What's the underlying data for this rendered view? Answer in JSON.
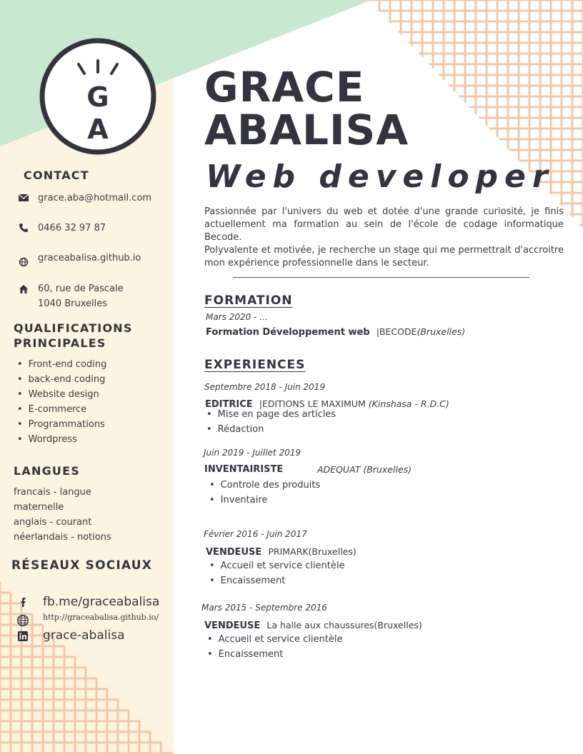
{
  "colors": {
    "mint": "#c9e8d0",
    "cream": "#fcf4e0",
    "grid": "#f1c6a3",
    "dark": "#33343f"
  },
  "logo": {
    "initial_top": "G",
    "initial_bottom": "A"
  },
  "header": {
    "first_name": "GRACE",
    "last_name": "ABALISA",
    "job_title": "Web developer"
  },
  "summary": {
    "p1": "Passionnée par l'univers du web et dotée d'une grande curiosité, je finis actuellement ma formation au sein de l'école de codage informatique Becode.",
    "p2": "Polyvalente et motivée, je recherche un stage qui me permettrait d'accroitre mon expérience professionnelle dans le secteur."
  },
  "contact": {
    "heading": "CONTACT",
    "items": [
      {
        "icon": "envelope-icon",
        "text": "grace.aba@hotmail.com"
      },
      {
        "icon": "phone-icon",
        "text": "0466 32 97 87"
      },
      {
        "icon": "globe-icon",
        "text": "graceabalisa.github.io"
      },
      {
        "icon": "home-icon",
        "line1": "60, rue de Pascale",
        "line2": "1040 Bruxelles"
      }
    ]
  },
  "qualifications": {
    "heading_line1": "QUALIFICATIONS",
    "heading_line2": "PRINCIPALES",
    "items": [
      "Front-end coding",
      "back-end coding",
      "Website design",
      "E-commerce",
      "Programmations",
      "Wordpress"
    ]
  },
  "languages": {
    "heading": "LANGUES",
    "lines": [
      "francais - langue",
      "maternelle",
      "anglais - courant",
      "néerlandais - notions"
    ]
  },
  "social": {
    "heading": "RÉSEAUX SOCIAUX",
    "facebook": "fb.me/graceabalisa",
    "website": "http://graceabalisa.github.io/",
    "linkedin": "grace-abalisa"
  },
  "formation": {
    "heading": "FORMATION",
    "date": "Mars 2020 - ...",
    "title": "Formation Développement web",
    "org": "|BECODE",
    "location": "(Bruxelles)"
  },
  "experiences": {
    "heading": "EXPERIENCES",
    "jobs": [
      {
        "date": "Septembre 2018 - Juin 2019",
        "role": "EDITRICE",
        "company": "|EDITIONS LE MAXIMUM ",
        "location": "(Kinshasa - R.D.C)",
        "tasks": [
          "Mise en page des articles",
          "Rédaction"
        ]
      },
      {
        "date": "Juin 2019 - Juillet 2019",
        "role": "INVENTAIRISTE",
        "company": "",
        "location": "ADEQUAT (Bruxelles)",
        "tasks": [
          "Controle des produits",
          "Inventaire"
        ]
      },
      {
        "date": "Février 2016 - Juin 2017",
        "role": "VENDEUSE",
        "company": "PRIMARK(Bruxelles)",
        "location": "",
        "tasks": [
          "Accueil et service clientèle",
          "Encaissement"
        ]
      },
      {
        "date": "Mars 2015 - Septembre 2016",
        "role": "VENDEUSE",
        "company": "La halle aux chaussures(Bruxelles)",
        "location": "",
        "tasks": [
          "Accueil et service clientèle",
          "Encaissement"
        ]
      }
    ]
  }
}
